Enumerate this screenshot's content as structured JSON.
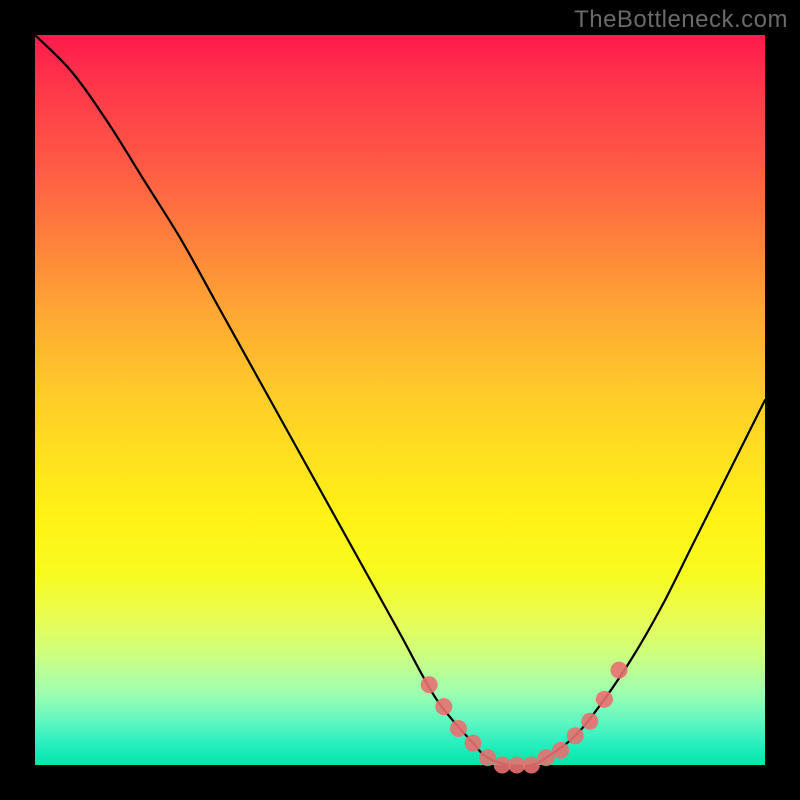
{
  "watermark": "TheBottleneck.com",
  "chart_data": {
    "type": "line",
    "title": "",
    "xlabel": "",
    "ylabel": "",
    "xlim": [
      0,
      100
    ],
    "ylim": [
      0,
      100
    ],
    "series": [
      {
        "name": "bottleneck-curve",
        "x": [
          0,
          5,
          10,
          15,
          20,
          25,
          30,
          35,
          40,
          45,
          50,
          55,
          60,
          62,
          65,
          68,
          70,
          74,
          78,
          82,
          86,
          90,
          94,
          100
        ],
        "values": [
          100,
          95,
          88,
          80,
          72,
          63,
          54,
          45,
          36,
          27,
          18,
          9,
          3,
          1,
          0,
          0,
          1,
          4,
          9,
          15,
          22,
          30,
          38,
          50
        ]
      }
    ],
    "markers": {
      "name": "optimal-range-markers",
      "x": [
        54,
        56,
        58,
        60,
        62,
        64,
        66,
        68,
        70,
        72,
        74,
        76,
        78,
        80
      ],
      "values": [
        11,
        8,
        5,
        3,
        1,
        0,
        0,
        0,
        1,
        2,
        4,
        6,
        9,
        13
      ]
    },
    "background": {
      "type": "gradient",
      "direction": "vertical",
      "stops": [
        {
          "pos": 0.0,
          "color": "#ff1a4d"
        },
        {
          "pos": 0.5,
          "color": "#ffd227"
        },
        {
          "pos": 0.8,
          "color": "#e8fd55"
        },
        {
          "pos": 1.0,
          "color": "#00e6a8"
        }
      ]
    }
  }
}
